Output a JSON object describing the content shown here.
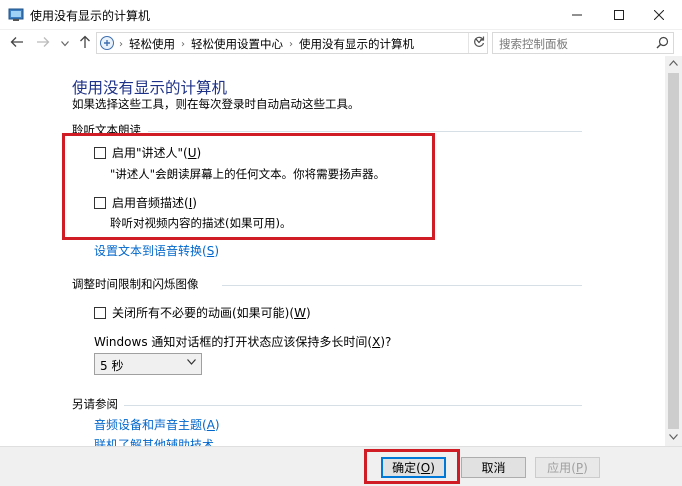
{
  "window": {
    "title": "使用没有显示的计算机",
    "controls": [
      "minimize-icon",
      "maximize-icon",
      "close-icon"
    ]
  },
  "navigation": {
    "breadcrumbs": [
      "轻松使用",
      "轻松使用设置中心",
      "使用没有显示的计算机"
    ],
    "search_placeholder": "搜索控制面板"
  },
  "main": {
    "heading": "使用没有显示的计算机",
    "subtitle": "如果选择这些工具，则在每次登录时自动启动这些工具。",
    "sections": {
      "listen": {
        "title": "聆听文本朗读",
        "narrator": {
          "label": "启用\"讲述人\"",
          "hotkey": "U",
          "checked": false,
          "description": "\"讲述人\"会朗读屏幕上的任何文本。你将需要扬声器。"
        },
        "audio_description": {
          "label": "启用音频描述",
          "hotkey": "I",
          "checked": false,
          "description": "聆听对视频内容的描述(如果可用)。"
        },
        "tts_link": {
          "label": "设置文本到语音转换",
          "hotkey": "S"
        }
      },
      "timing": {
        "title": "调整时间限制和闪烁图像",
        "animations": {
          "label": "关闭所有不必要的动画(如果可能)",
          "hotkey": "W",
          "checked": false
        },
        "notification_question": {
          "label": "Windows 通知对话框的打开状态应该保持多长时间",
          "hotkey": "X",
          "suffix": "?"
        },
        "duration_select": {
          "value": "5 秒"
        }
      },
      "see_also": {
        "title": "另请参阅",
        "links": [
          {
            "label": "音频设备和声音主题",
            "hotkey": "A"
          },
          {
            "label": "联机了解其他辅助技术",
            "hotkey": ""
          }
        ]
      }
    }
  },
  "footer": {
    "ok": {
      "label": "确定",
      "hotkey": "O"
    },
    "cancel": {
      "label": "取消"
    },
    "apply": {
      "label": "应用",
      "hotkey": "P"
    }
  },
  "colors": {
    "heading": "#1e3287",
    "link": "#0066cc",
    "highlight": "#d01c24",
    "footer_bg": "#f0f0f0"
  }
}
